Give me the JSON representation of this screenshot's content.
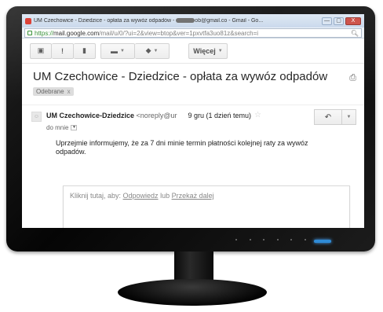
{
  "browser": {
    "tab_title": "UM Czechowice - Dziedzice - opłata za wywóz odpadów - ",
    "tab_title_suffix": "ob@gmail.co - Gmail - Go...",
    "window_buttons": [
      "—",
      "▢",
      "X"
    ],
    "url_https": "https://",
    "url_host": "mail.google.com",
    "url_rest": "/mail/u/0/?ui=2&view=btop&ver=1pxvtfa3uo81z&search=i",
    "zoom_icon": "magnifier-icon"
  },
  "toolbar": {
    "archive_icon": "archive-icon",
    "spam_icon": "report-spam-icon",
    "delete_icon": "trash-icon",
    "move_icon": "folder-icon",
    "labels_icon": "label-icon",
    "more_label": "Więcej"
  },
  "message": {
    "subject": "UM Czechowice - Dziedzice - opłata za wywóz odpadów",
    "label_chip": "Odebrane",
    "label_remove": "x",
    "sender_name": "UM Czechowice-Dziedzice",
    "sender_email": "<noreply@ur",
    "date": "9 gru (1 dzień temu)",
    "to_line": "do mnie",
    "body": "Uprzejmie informujemy, że za 7 dni minie termin płatności kolejnej raty za wywóz odpadów."
  },
  "reply": {
    "prefix": "Kliknij tutaj, aby: ",
    "reply_link": "Odpowiedz",
    "middle": " lub ",
    "forward_link": "Przekaż dalej"
  },
  "colors": {
    "url_green": "#2a8a2a",
    "power_led": "#2f8bd6",
    "close_button": "#c9443b"
  }
}
